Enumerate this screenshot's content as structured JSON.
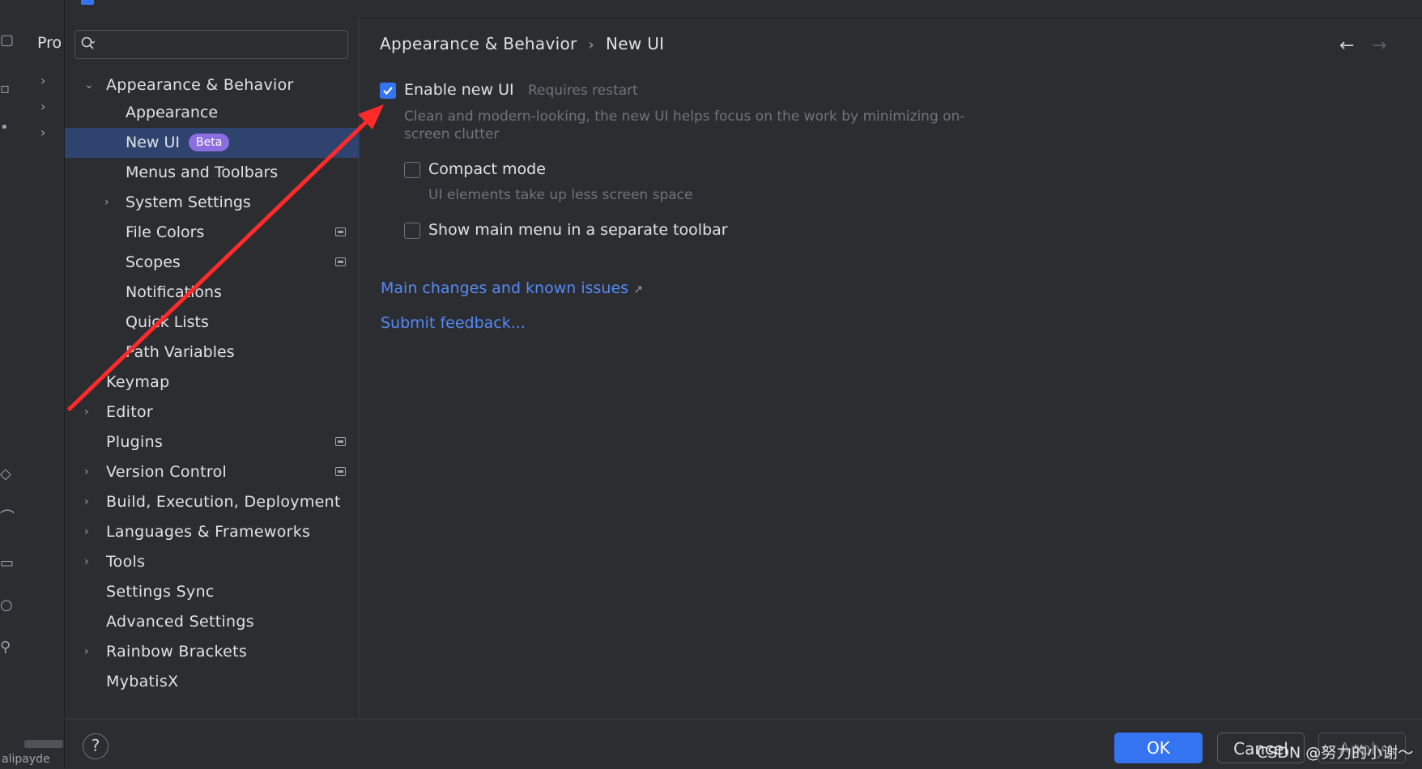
{
  "ide": {
    "project_label": "Pro",
    "bottom_text": "alipayde"
  },
  "search": {
    "placeholder": "",
    "value": ""
  },
  "nav": {
    "items": [
      {
        "label": "Appearance & Behavior",
        "level": "top",
        "chevron": "down"
      },
      {
        "label": "Appearance",
        "level": "sub"
      },
      {
        "label": "New UI",
        "level": "sub",
        "selected": true,
        "badge": "Beta"
      },
      {
        "label": "Menus and Toolbars",
        "level": "sub"
      },
      {
        "label": "System Settings",
        "level": "sub",
        "chevron": "right"
      },
      {
        "label": "File Colors",
        "level": "sub",
        "project_icon": true
      },
      {
        "label": "Scopes",
        "level": "sub",
        "project_icon": true
      },
      {
        "label": "Notifications",
        "level": "sub"
      },
      {
        "label": "Quick Lists",
        "level": "sub"
      },
      {
        "label": "Path Variables",
        "level": "sub"
      },
      {
        "label": "Keymap",
        "level": "top"
      },
      {
        "label": "Editor",
        "level": "top",
        "chevron": "right"
      },
      {
        "label": "Plugins",
        "level": "top",
        "project_icon": true
      },
      {
        "label": "Version Control",
        "level": "top",
        "chevron": "right",
        "project_icon": true
      },
      {
        "label": "Build, Execution, Deployment",
        "level": "top",
        "chevron": "right"
      },
      {
        "label": "Languages & Frameworks",
        "level": "top",
        "chevron": "right"
      },
      {
        "label": "Tools",
        "level": "top",
        "chevron": "right"
      },
      {
        "label": "Settings Sync",
        "level": "top"
      },
      {
        "label": "Advanced Settings",
        "level": "top"
      },
      {
        "label": "Rainbow Brackets",
        "level": "top",
        "chevron": "right"
      },
      {
        "label": "MybatisX",
        "level": "top"
      }
    ]
  },
  "breadcrumb": {
    "parent": "Appearance & Behavior",
    "separator": "›",
    "current": "New UI"
  },
  "content": {
    "enable_new_ui": {
      "label": "Enable new UI",
      "checked": true,
      "hint": "Requires restart",
      "description": "Clean and modern-looking, the new UI helps focus on the work by minimizing on-screen clutter"
    },
    "compact_mode": {
      "label": "Compact mode",
      "checked": false,
      "hint": "UI elements take up less screen space"
    },
    "main_menu_toolbar": {
      "label": "Show main menu in a separate toolbar",
      "checked": false
    },
    "link_changes": "Main changes and known issues",
    "link_changes_icon": "↗",
    "link_feedback": "Submit feedback..."
  },
  "footer": {
    "help": "?",
    "ok": "OK",
    "cancel": "Cancel",
    "apply": "Apply"
  },
  "watermark": "CSDN @努力的小谢～",
  "colors": {
    "background": "#2b2d30",
    "selection": "#2e436e",
    "accent": "#3574f0",
    "link": "#548af7",
    "badge": "#8c6ee1",
    "annotation_arrow": "#ff2a2a"
  }
}
